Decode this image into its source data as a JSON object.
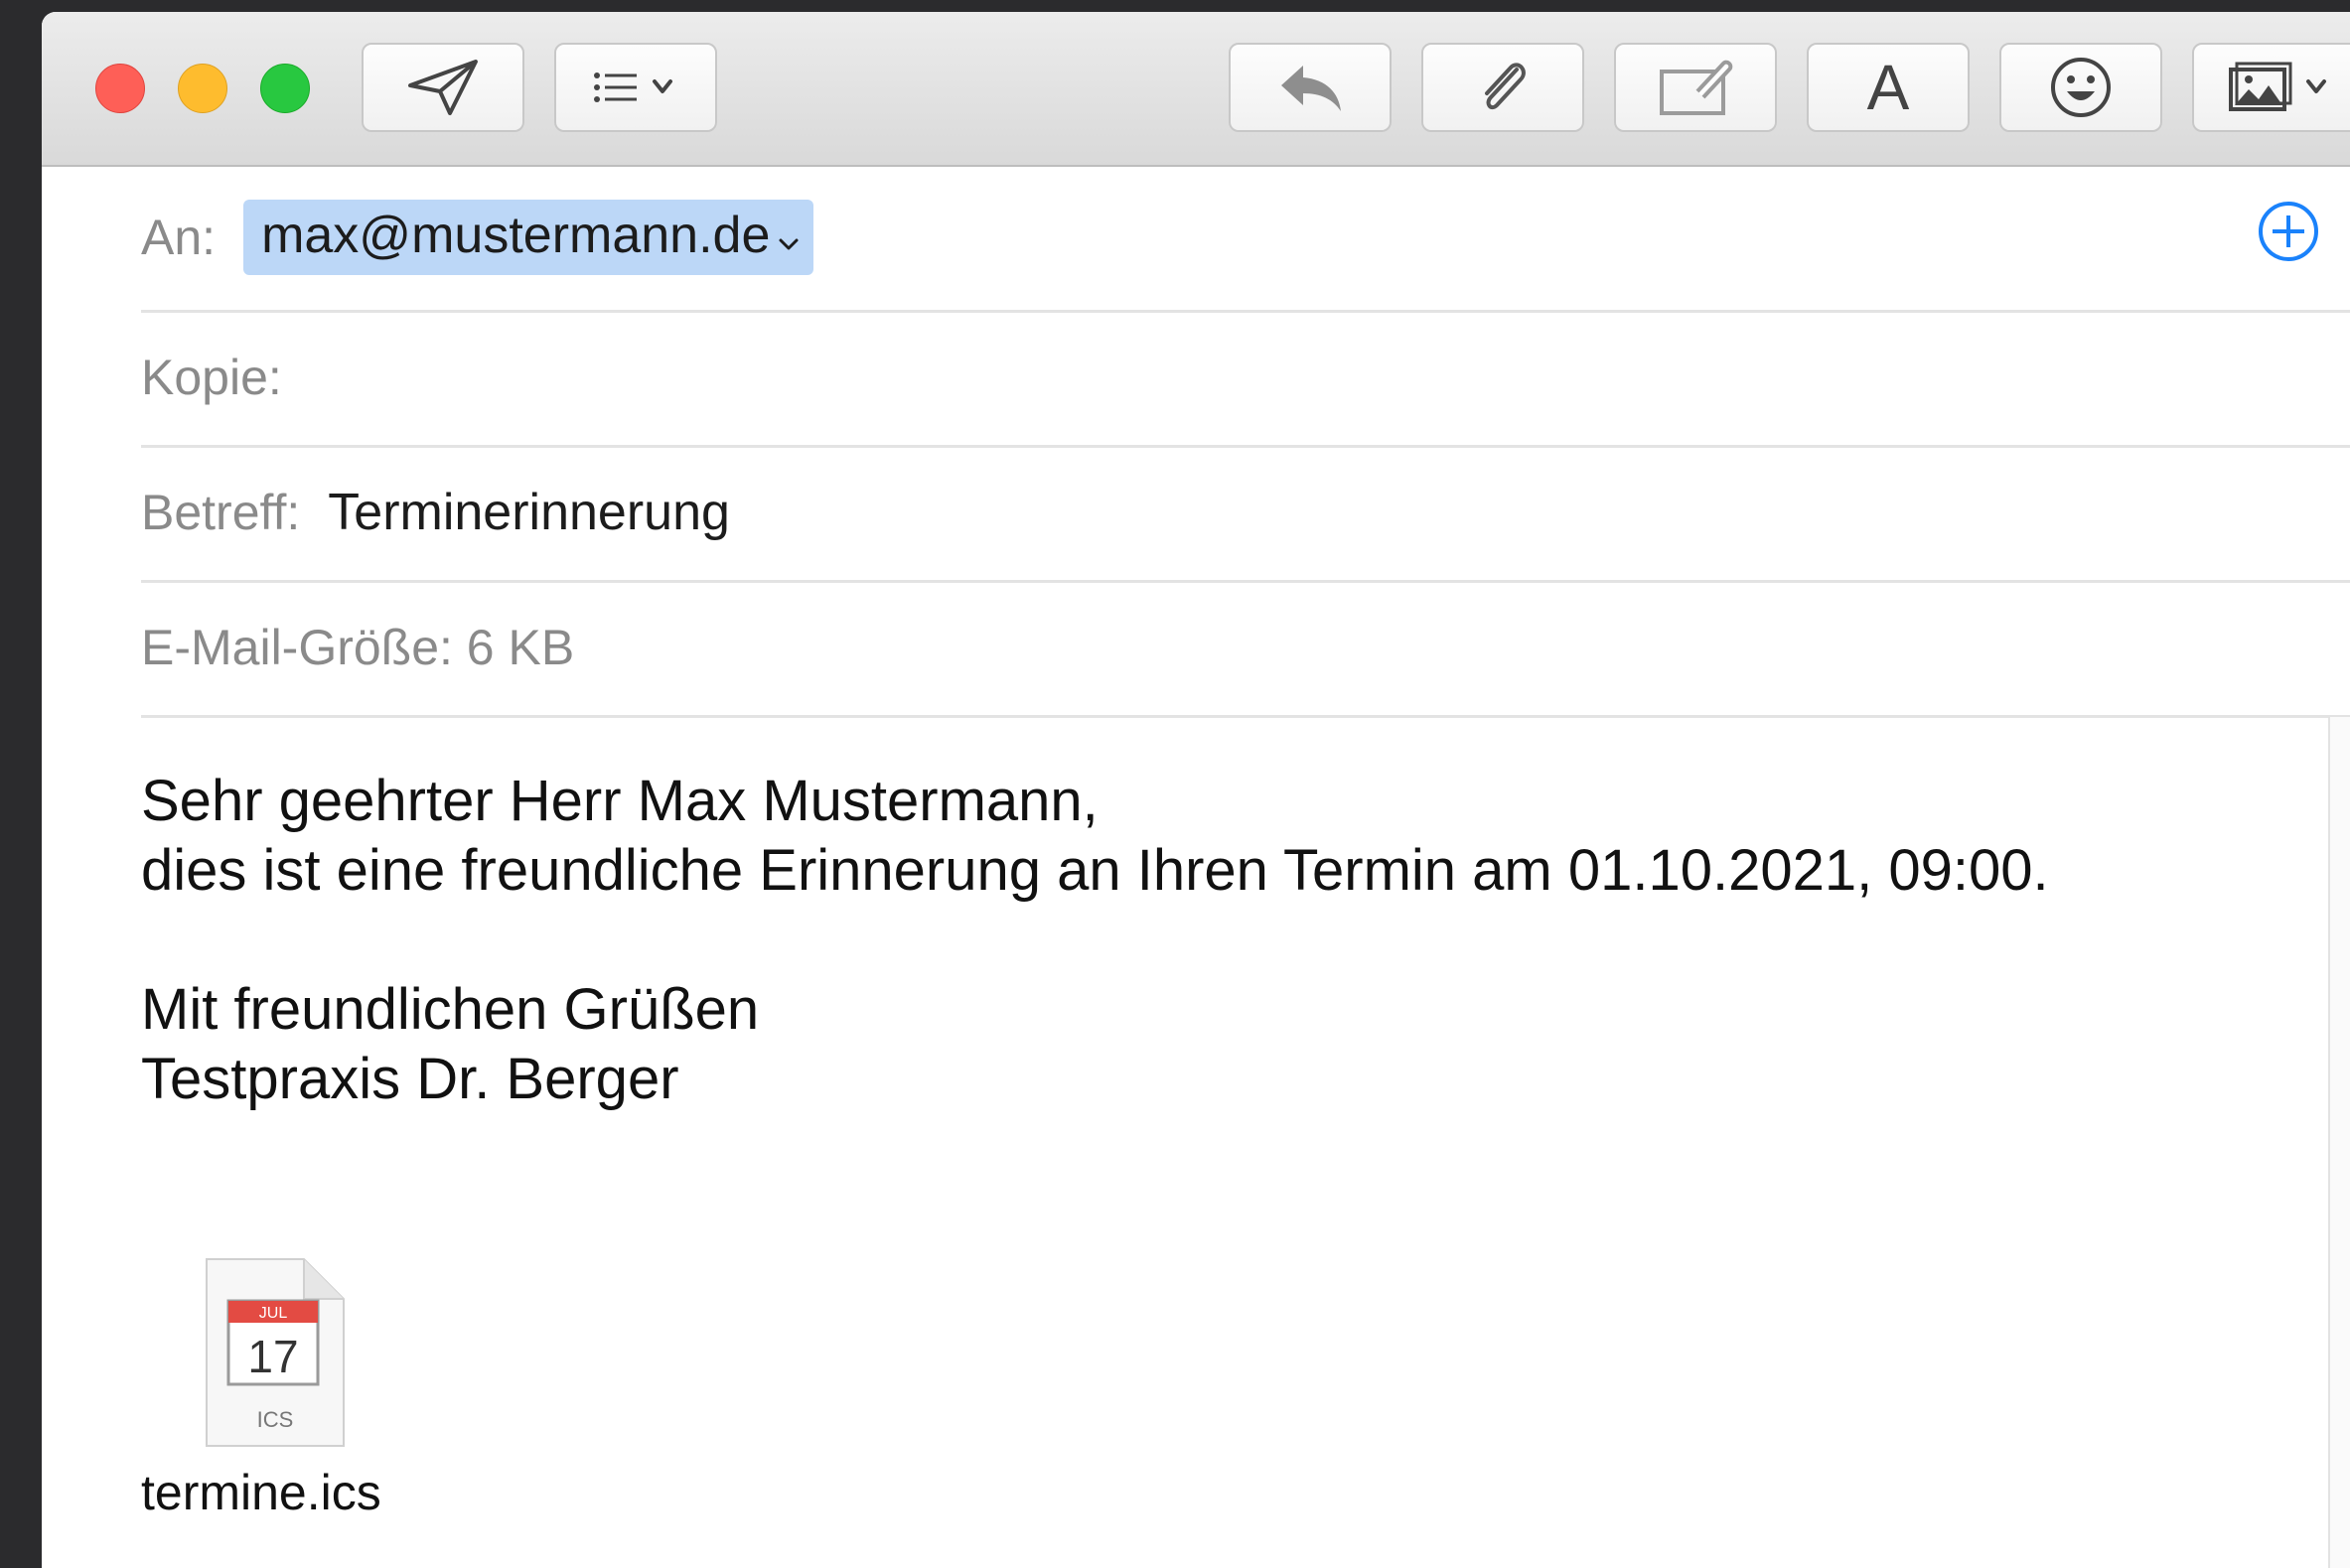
{
  "toolbar": {
    "buttons": [
      {
        "name": "send",
        "icon": "paper-plane-icon"
      },
      {
        "name": "header-fields",
        "icon": "list-icon"
      },
      {
        "name": "reply",
        "icon": "reply-arrow-icon"
      },
      {
        "name": "attach",
        "icon": "paperclip-icon"
      },
      {
        "name": "markup",
        "icon": "markup-icon"
      },
      {
        "name": "format",
        "label": "A"
      },
      {
        "name": "emoji",
        "icon": "smiley-icon"
      },
      {
        "name": "photo-browser",
        "icon": "photo-icon"
      }
    ]
  },
  "header": {
    "to_label": "An:",
    "to_recipient": "max@mustermann.de",
    "cc_label": "Kopie:",
    "subject_label": "Betreff:",
    "subject_value": "Terminerinnerung",
    "size_text": "E-Mail-Größe: 6 KB"
  },
  "body": {
    "line1": "Sehr geehrter Herr Max Mustermann,",
    "line2": "dies ist eine freundliche Erinnerung an Ihren Termin am 01.10.2021, 09:00.",
    "line3": "Mit freundlichen Grüßen",
    "line4": "Testpraxis Dr. Berger"
  },
  "attachment": {
    "filename": "termine.ics",
    "icon_month": "JUL",
    "icon_day": "17",
    "icon_type": "ICS"
  },
  "colors": {
    "recipient_highlight": "#bcd7f7",
    "accent": "#1a82fb",
    "close": "#fe5f57",
    "minimize": "#febc2e",
    "zoom": "#28c840"
  }
}
